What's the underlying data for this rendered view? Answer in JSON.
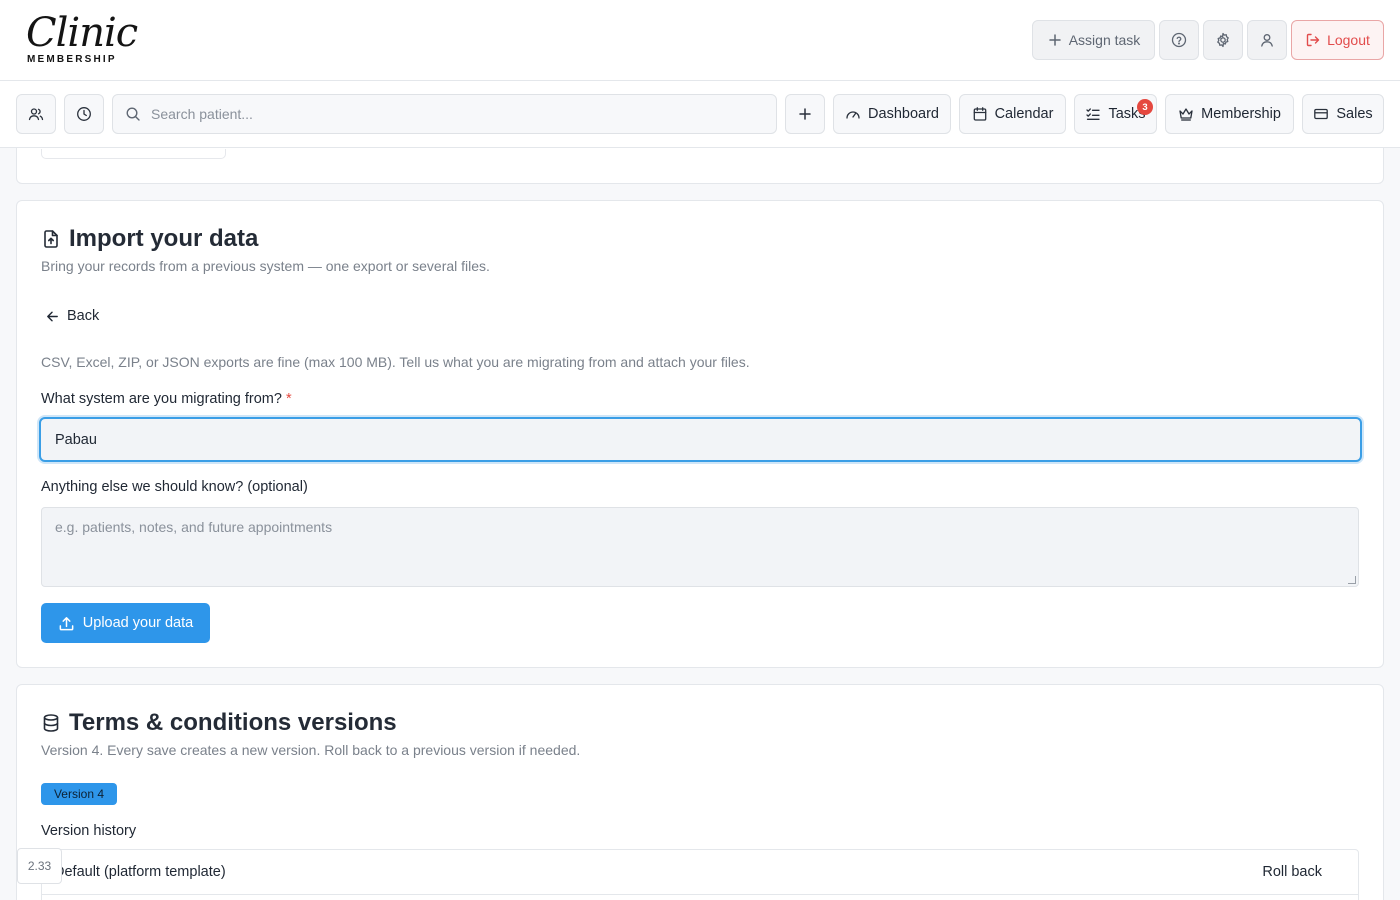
{
  "header": {
    "logo_script": "Clinic",
    "logo_sub": "MEMBERSHIP",
    "assign_task_label": "Assign task",
    "logout_label": "Logout"
  },
  "nav": {
    "search_placeholder": "Search patient...",
    "dashboard_label": "Dashboard",
    "calendar_label": "Calendar",
    "tasks_label": "Tasks",
    "tasks_badge": "3",
    "membership_label": "Membership",
    "sales_label": "Sales"
  },
  "import": {
    "title": "Import your data",
    "subtitle": "Bring your records from a previous system — one export or several files.",
    "back_label": "Back",
    "hint": "CSV, Excel, ZIP, or JSON exports are fine (max 100 MB). Tell us what you are migrating from and attach your files.",
    "system_label": "What system are you migrating from?",
    "required_mark": "*",
    "system_value": "Pabau",
    "notes_label": "Anything else we should know? (optional)",
    "notes_placeholder": "e.g. patients, notes, and future appointments",
    "upload_label": "Upload your data"
  },
  "terms": {
    "title": "Terms & conditions versions",
    "subtitle": "Version 4. Every save creates a new version. Roll back to a previous version if needed.",
    "version_badge": "Version 4",
    "history_label": "Version history",
    "rows": [
      {
        "name": "Default (platform template)",
        "action": "Roll back"
      }
    ]
  },
  "app_version": "2.33",
  "colors": {
    "primary": "#2e96ea",
    "danger": "#e5483f",
    "text": "#1f2733",
    "muted": "#7a818b"
  }
}
